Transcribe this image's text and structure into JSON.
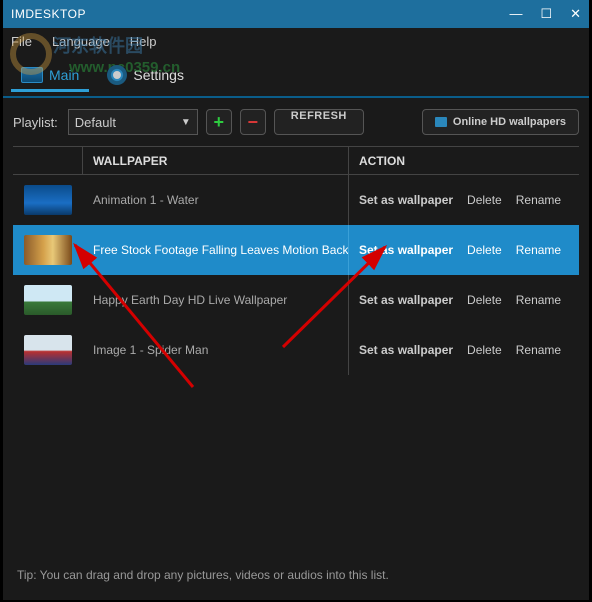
{
  "window": {
    "title": "IMDESKTOP"
  },
  "menu": {
    "file": "File",
    "language": "Language",
    "help": "Help"
  },
  "watermark": {
    "line1": "河东软件园",
    "line2": "www.pc0359.cn"
  },
  "tabs": {
    "main": "Main",
    "settings": "Settings"
  },
  "toolbar": {
    "playlist_label": "Playlist:",
    "dropdown_value": "Default",
    "refresh": "REFRESH",
    "online": "Online HD wallpapers"
  },
  "table": {
    "head_wallpaper": "WALLPAPER",
    "head_action": "ACTION",
    "action_set": "Set as wallpaper",
    "action_delete": "Delete",
    "action_rename": "Rename",
    "rows": [
      {
        "name": "Animation 1 - Water",
        "selected": false,
        "thumb": "linear-gradient(#0a4b8a,#1a6ec4 60%,#0a3a6a)"
      },
      {
        "name": "Free Stock Footage Falling Leaves Motion Backg",
        "selected": true,
        "thumb": "linear-gradient(90deg,#8a5a2a,#d4a04a 40%,#e8c878 60%,#7a4a1a)"
      },
      {
        "name": "Happy Earth Day HD Live Wallpaper",
        "selected": false,
        "thumb": "linear-gradient(#cfe8f4 55%,#3a7a3a 55%,#2a5a2a)"
      },
      {
        "name": "Image 1 - Spider Man",
        "selected": false,
        "thumb": "linear-gradient(#d8e4ec 50%,#b83030 55%,#2a3a7a)"
      }
    ]
  },
  "tip": "Tip: You can drag and drop any pictures, videos or audios into this list."
}
